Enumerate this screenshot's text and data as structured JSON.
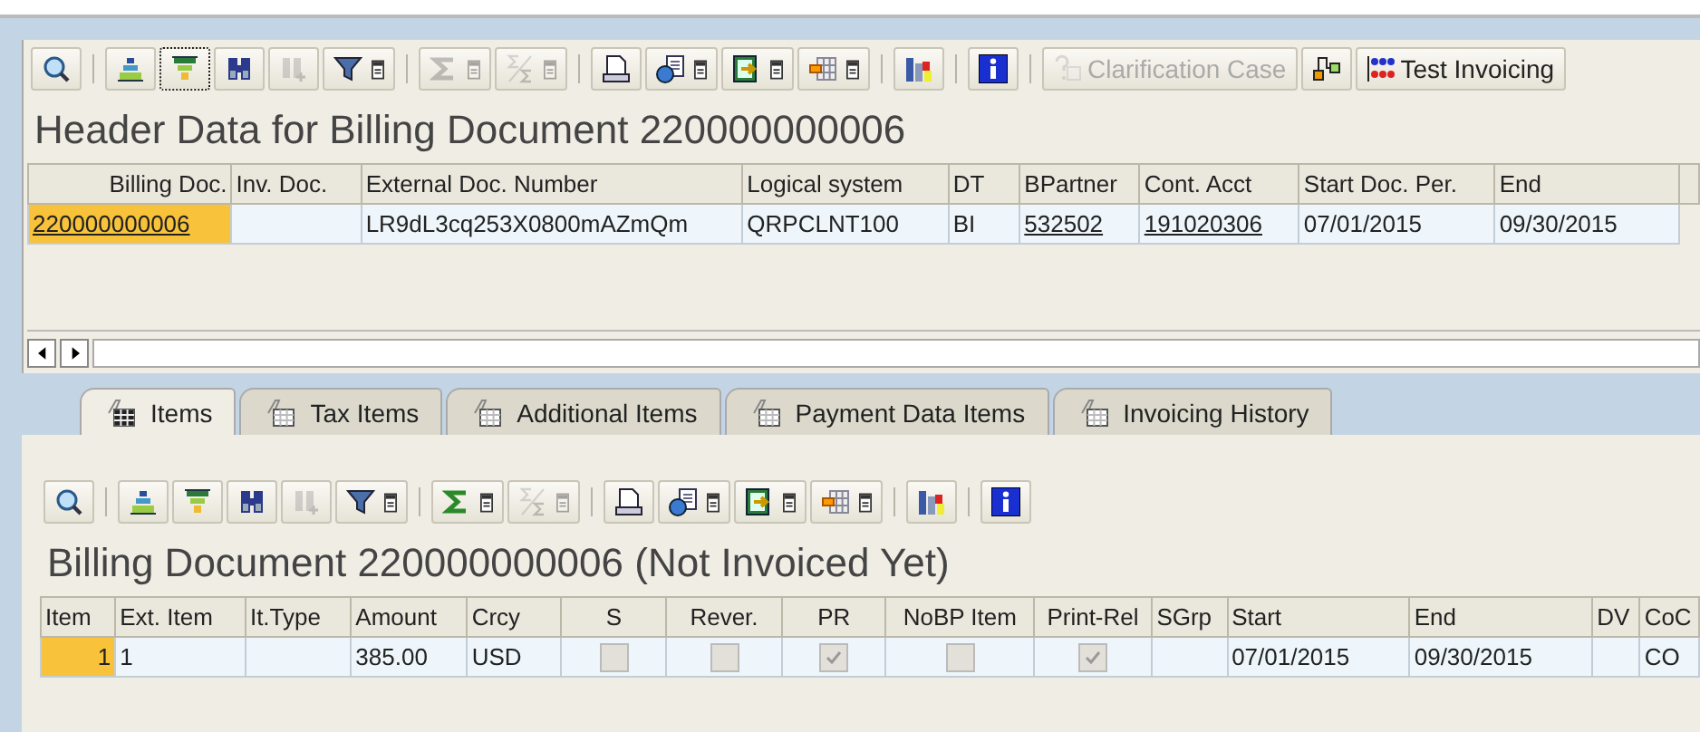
{
  "header_toolbar": [
    [
      {
        "kind": "details",
        "disabled": false,
        "dropdown": false,
        "focused": false
      }
    ],
    [
      {
        "kind": "sort-asc",
        "disabled": false,
        "dropdown": false,
        "focused": false
      },
      {
        "kind": "sort-desc",
        "disabled": false,
        "dropdown": false,
        "focused": true
      },
      {
        "kind": "find",
        "disabled": false,
        "dropdown": false,
        "focused": false
      },
      {
        "kind": "find-next",
        "disabled": true,
        "dropdown": false,
        "focused": false
      },
      {
        "kind": "filter",
        "disabled": false,
        "dropdown": true,
        "focused": false
      }
    ],
    [
      {
        "kind": "sum",
        "disabled": true,
        "dropdown": true,
        "focused": false
      },
      {
        "kind": "subtotal",
        "disabled": true,
        "dropdown": true,
        "focused": false
      }
    ],
    [
      {
        "kind": "print",
        "disabled": false,
        "dropdown": false,
        "focused": false
      },
      {
        "kind": "export",
        "disabled": false,
        "dropdown": true,
        "focused": false
      },
      {
        "kind": "spreadsheet",
        "disabled": false,
        "dropdown": true,
        "focused": false
      },
      {
        "kind": "layout",
        "disabled": false,
        "dropdown": true,
        "focused": false
      }
    ],
    [
      {
        "kind": "chart",
        "disabled": false,
        "dropdown": false,
        "focused": false
      }
    ],
    [
      {
        "kind": "info",
        "disabled": false,
        "dropdown": false,
        "focused": false
      }
    ],
    [
      {
        "kind": "clarification",
        "label": "Clarification Case",
        "disabled": true,
        "dropdown": false,
        "focused": false
      },
      {
        "kind": "hierarchy",
        "disabled": false,
        "dropdown": false,
        "focused": false
      },
      {
        "kind": "test",
        "label": "Test Invoicing",
        "disabled": false,
        "dropdown": false,
        "focused": false
      }
    ]
  ],
  "header_title": "Header Data for Billing Document 220000000006",
  "header_table": {
    "columns": [
      "Billing Doc.",
      "Inv. Doc.",
      "External Doc. Number",
      "Logical system",
      "DT",
      "BPartner",
      "Cont. Acct",
      "Start Doc. Per.",
      "End"
    ],
    "rows": [
      [
        {
          "kind": "text",
          "text": "220000000006",
          "link": true,
          "focused": true
        },
        {
          "kind": "empty"
        },
        {
          "kind": "text",
          "text": "LR9dL3cq253X0800mAZmQm",
          "link": false,
          "focused": false
        },
        {
          "kind": "text",
          "text": "QRPCLNT100",
          "link": false,
          "focused": false
        },
        {
          "kind": "text",
          "text": "BI",
          "link": false,
          "focused": false
        },
        {
          "kind": "text",
          "text": "532502",
          "link": true,
          "focused": false
        },
        {
          "kind": "text",
          "text": "191020306",
          "link": true,
          "focused": false
        },
        {
          "kind": "text",
          "text": "07/01/2015",
          "link": false,
          "focused": false
        },
        {
          "kind": "text",
          "text": "09/30/2015",
          "link": false,
          "focused": false
        }
      ]
    ]
  },
  "tabs": [
    {
      "label": "Items",
      "selected": true
    },
    {
      "label": "Tax Items",
      "selected": false
    },
    {
      "label": "Additional Items",
      "selected": false
    },
    {
      "label": "Payment Data Items",
      "selected": false
    },
    {
      "label": "Invoicing History",
      "selected": false
    }
  ],
  "items_toolbar": [
    [
      {
        "kind": "details",
        "disabled": false,
        "dropdown": false,
        "focused": false
      }
    ],
    [
      {
        "kind": "sort-asc",
        "disabled": false,
        "dropdown": false,
        "focused": false
      },
      {
        "kind": "sort-desc",
        "disabled": false,
        "dropdown": false,
        "focused": false
      },
      {
        "kind": "find",
        "disabled": false,
        "dropdown": false,
        "focused": false
      },
      {
        "kind": "find-next",
        "disabled": true,
        "dropdown": false,
        "focused": false
      },
      {
        "kind": "filter",
        "disabled": false,
        "dropdown": true,
        "focused": false
      }
    ],
    [
      {
        "kind": "sum",
        "disabled": false,
        "dropdown": true,
        "focused": false
      },
      {
        "kind": "subtotal",
        "disabled": true,
        "dropdown": true,
        "focused": false
      }
    ],
    [
      {
        "kind": "print",
        "disabled": false,
        "dropdown": false,
        "focused": false
      },
      {
        "kind": "export",
        "disabled": false,
        "dropdown": true,
        "focused": false
      },
      {
        "kind": "spreadsheet",
        "disabled": false,
        "dropdown": true,
        "focused": false
      },
      {
        "kind": "layout",
        "disabled": false,
        "dropdown": true,
        "focused": false
      }
    ],
    [
      {
        "kind": "chart",
        "disabled": false,
        "dropdown": false,
        "focused": false
      }
    ],
    [
      {
        "kind": "info",
        "disabled": false,
        "dropdown": false,
        "focused": false
      }
    ]
  ],
  "items_title": "Billing Document 220000000006 (Not Invoiced Yet)",
  "items_table": {
    "columns": [
      "Item",
      "Ext. Item",
      "It.Type",
      "Amount",
      "Crcy",
      "S",
      "Rever.",
      "PR",
      "NoBP Item",
      "Print-Rel",
      "SGrp",
      "Start",
      "End",
      "DV",
      "CoC"
    ],
    "rows": [
      [
        {
          "kind": "text",
          "text": "1",
          "focused": true
        },
        {
          "kind": "text",
          "text": "1",
          "focused": false
        },
        {
          "kind": "empty"
        },
        {
          "kind": "text",
          "text": "385.00",
          "focused": false
        },
        {
          "kind": "text",
          "text": "USD",
          "focused": false
        },
        {
          "kind": "checkbox",
          "checked": false
        },
        {
          "kind": "checkbox",
          "checked": false
        },
        {
          "kind": "checkbox",
          "checked": true
        },
        {
          "kind": "checkbox",
          "checked": false
        },
        {
          "kind": "checkbox",
          "checked": true
        },
        {
          "kind": "empty"
        },
        {
          "kind": "text",
          "text": "07/01/2015",
          "focused": false
        },
        {
          "kind": "text",
          "text": "09/30/2015",
          "focused": false
        },
        {
          "kind": "empty"
        },
        {
          "kind": "text",
          "text": "CO",
          "focused": false
        }
      ]
    ]
  }
}
